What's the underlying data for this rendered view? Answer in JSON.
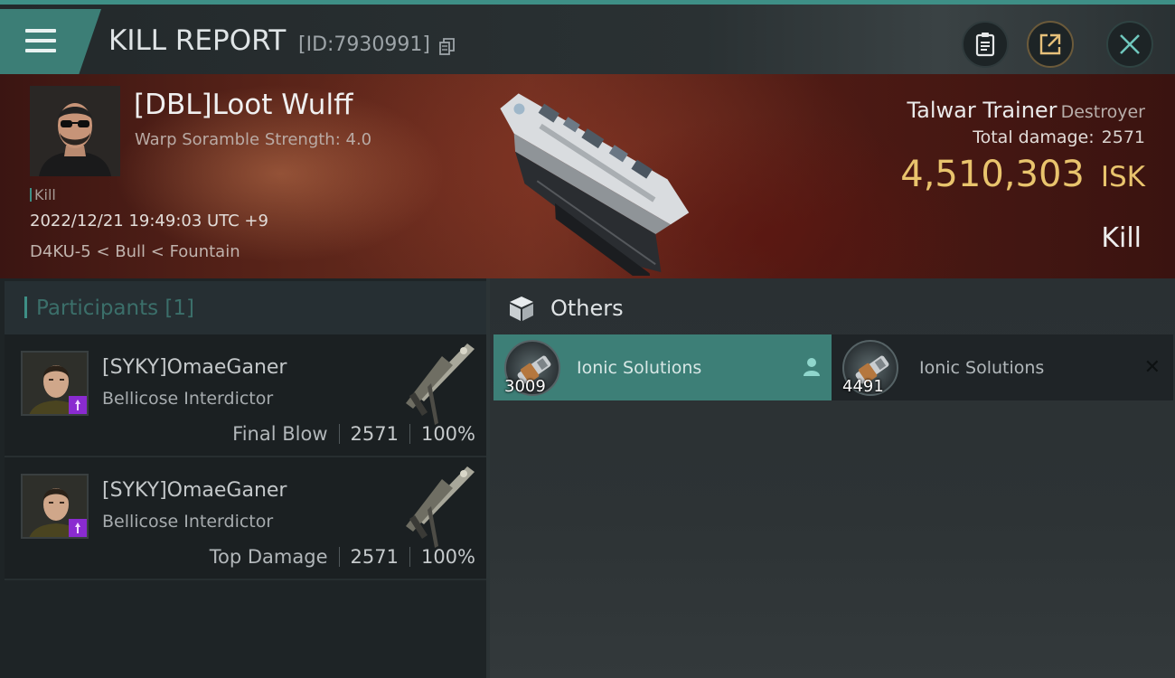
{
  "header": {
    "title": "KILL REPORT",
    "kill_id": "[ID:7930991]",
    "icons": [
      "menu-icon",
      "copy-icon",
      "clipboard-icon",
      "share-icon",
      "close-icon"
    ]
  },
  "victim": {
    "name": "[DBL]Loot Wulff",
    "detail": "Warp Soramble Strength: 4.0",
    "kill_tag": "Kill",
    "timestamp": "2022/12/21 19:49:03 UTC +9",
    "location": "D4KU-5 < Bull < Fountain",
    "ship": "Talwar Trainer",
    "ship_class": "Destroyer",
    "total_damage_label": "Total damage:",
    "total_damage": "2571",
    "isk_value": "4,510,303",
    "isk_unit": "ISK",
    "result": "Kill"
  },
  "participants_tab": {
    "label": "Participants",
    "count": "[1]"
  },
  "participants": [
    {
      "name": "[SYKY]OmaeGaner",
      "ship": "Bellicose Interdictor",
      "role": "Final Blow",
      "damage": "2571",
      "percent": "100%"
    },
    {
      "name": "[SYKY]OmaeGaner",
      "ship": "Bellicose Interdictor",
      "role": "Top Damage",
      "damage": "2571",
      "percent": "100%"
    }
  ],
  "others": {
    "label": "Others",
    "items": [
      {
        "name": "Ionic Solutions",
        "qty": "3009",
        "selected": true
      },
      {
        "name": "Ionic Solutions",
        "qty": "4491",
        "selected": false
      }
    ]
  },
  "colors": {
    "accent_teal": "#3d7f77",
    "isk_gold": "#e9c46d",
    "badge_purple": "#8a2bd0",
    "banner_red": "#5a2419"
  }
}
